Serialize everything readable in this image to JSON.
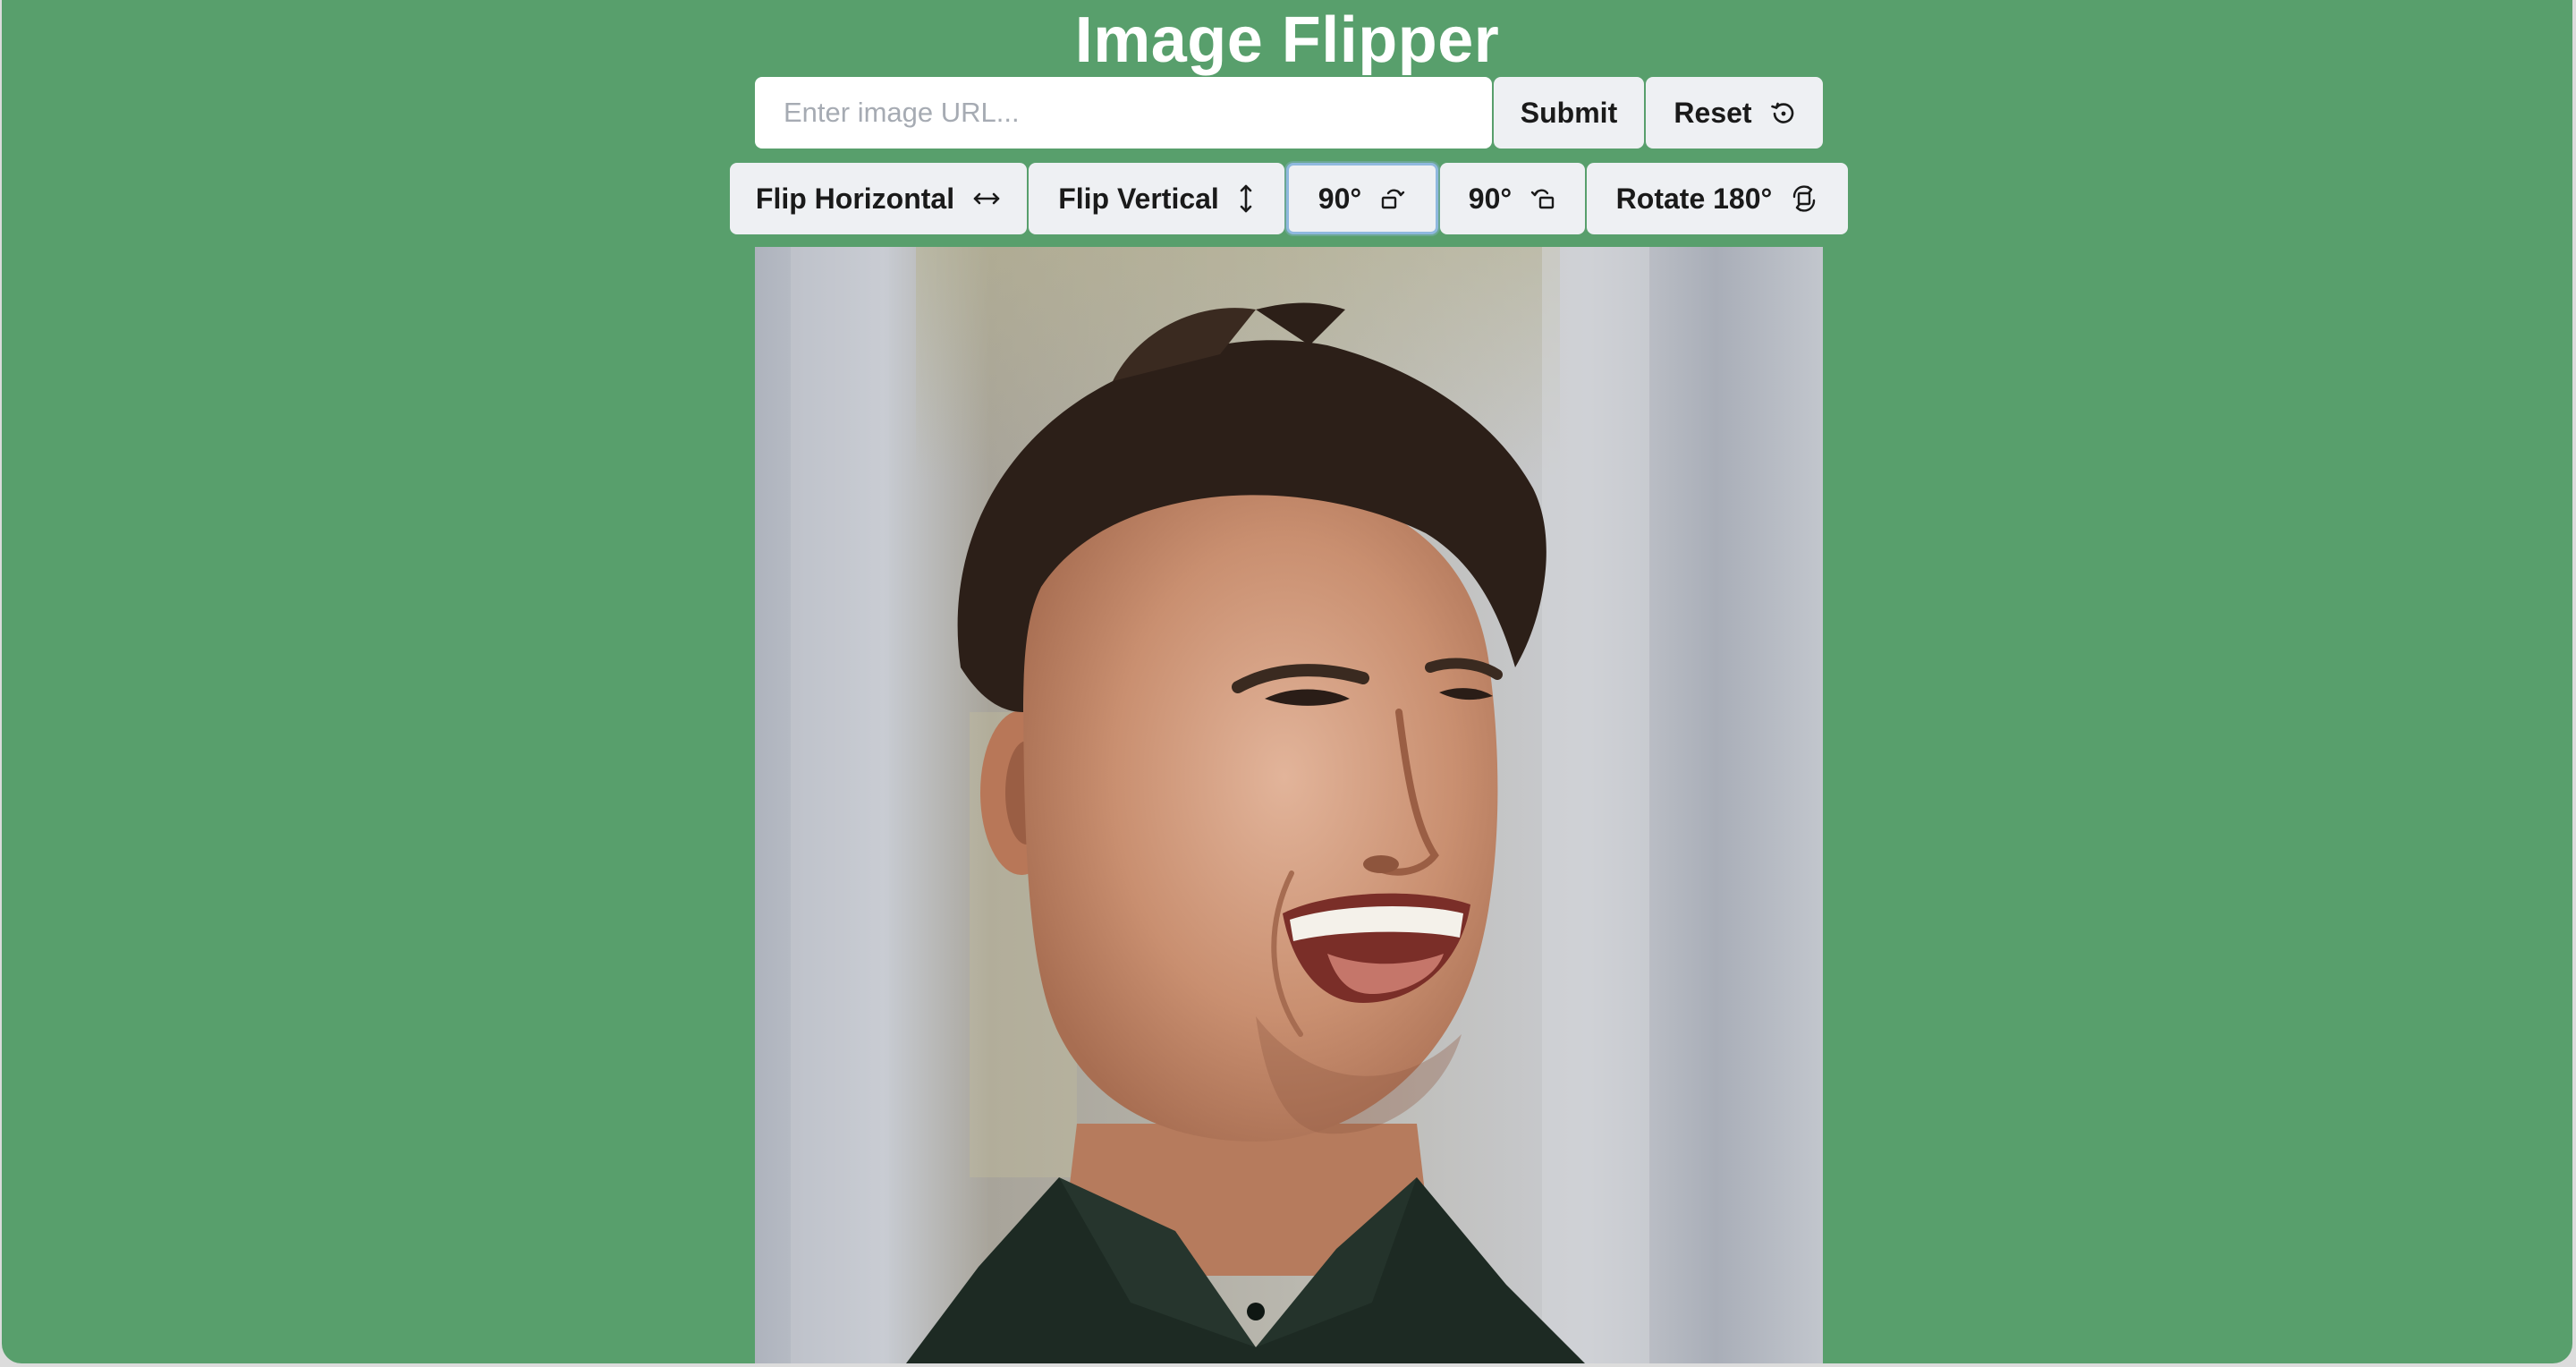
{
  "app": {
    "title": "Image Flipper"
  },
  "url_form": {
    "input_placeholder": "Enter image URL...",
    "input_value": "",
    "submit_label": "Submit",
    "reset_label": "Reset",
    "reset_icon": "reset-rotate-icon"
  },
  "toolbar": {
    "flip_horizontal_label": "Flip Horizontal",
    "flip_horizontal_icon": "horizontal-arrows-icon",
    "flip_vertical_label": "Flip Vertical",
    "flip_vertical_icon": "vertical-arrows-icon",
    "rotate_ccw_label": "90°",
    "rotate_ccw_icon": "rotate-counterclockwise-icon",
    "rotate_cw_label": "90°",
    "rotate_cw_icon": "rotate-clockwise-icon",
    "rotate_180_label": "Rotate 180°",
    "rotate_180_icon": "rotate-180-icon"
  },
  "image": {
    "subject": "photo",
    "colors": {
      "page_background": "#589f6c",
      "button_background": "#eef0f3",
      "focus_ring": "#8fb8de"
    }
  }
}
